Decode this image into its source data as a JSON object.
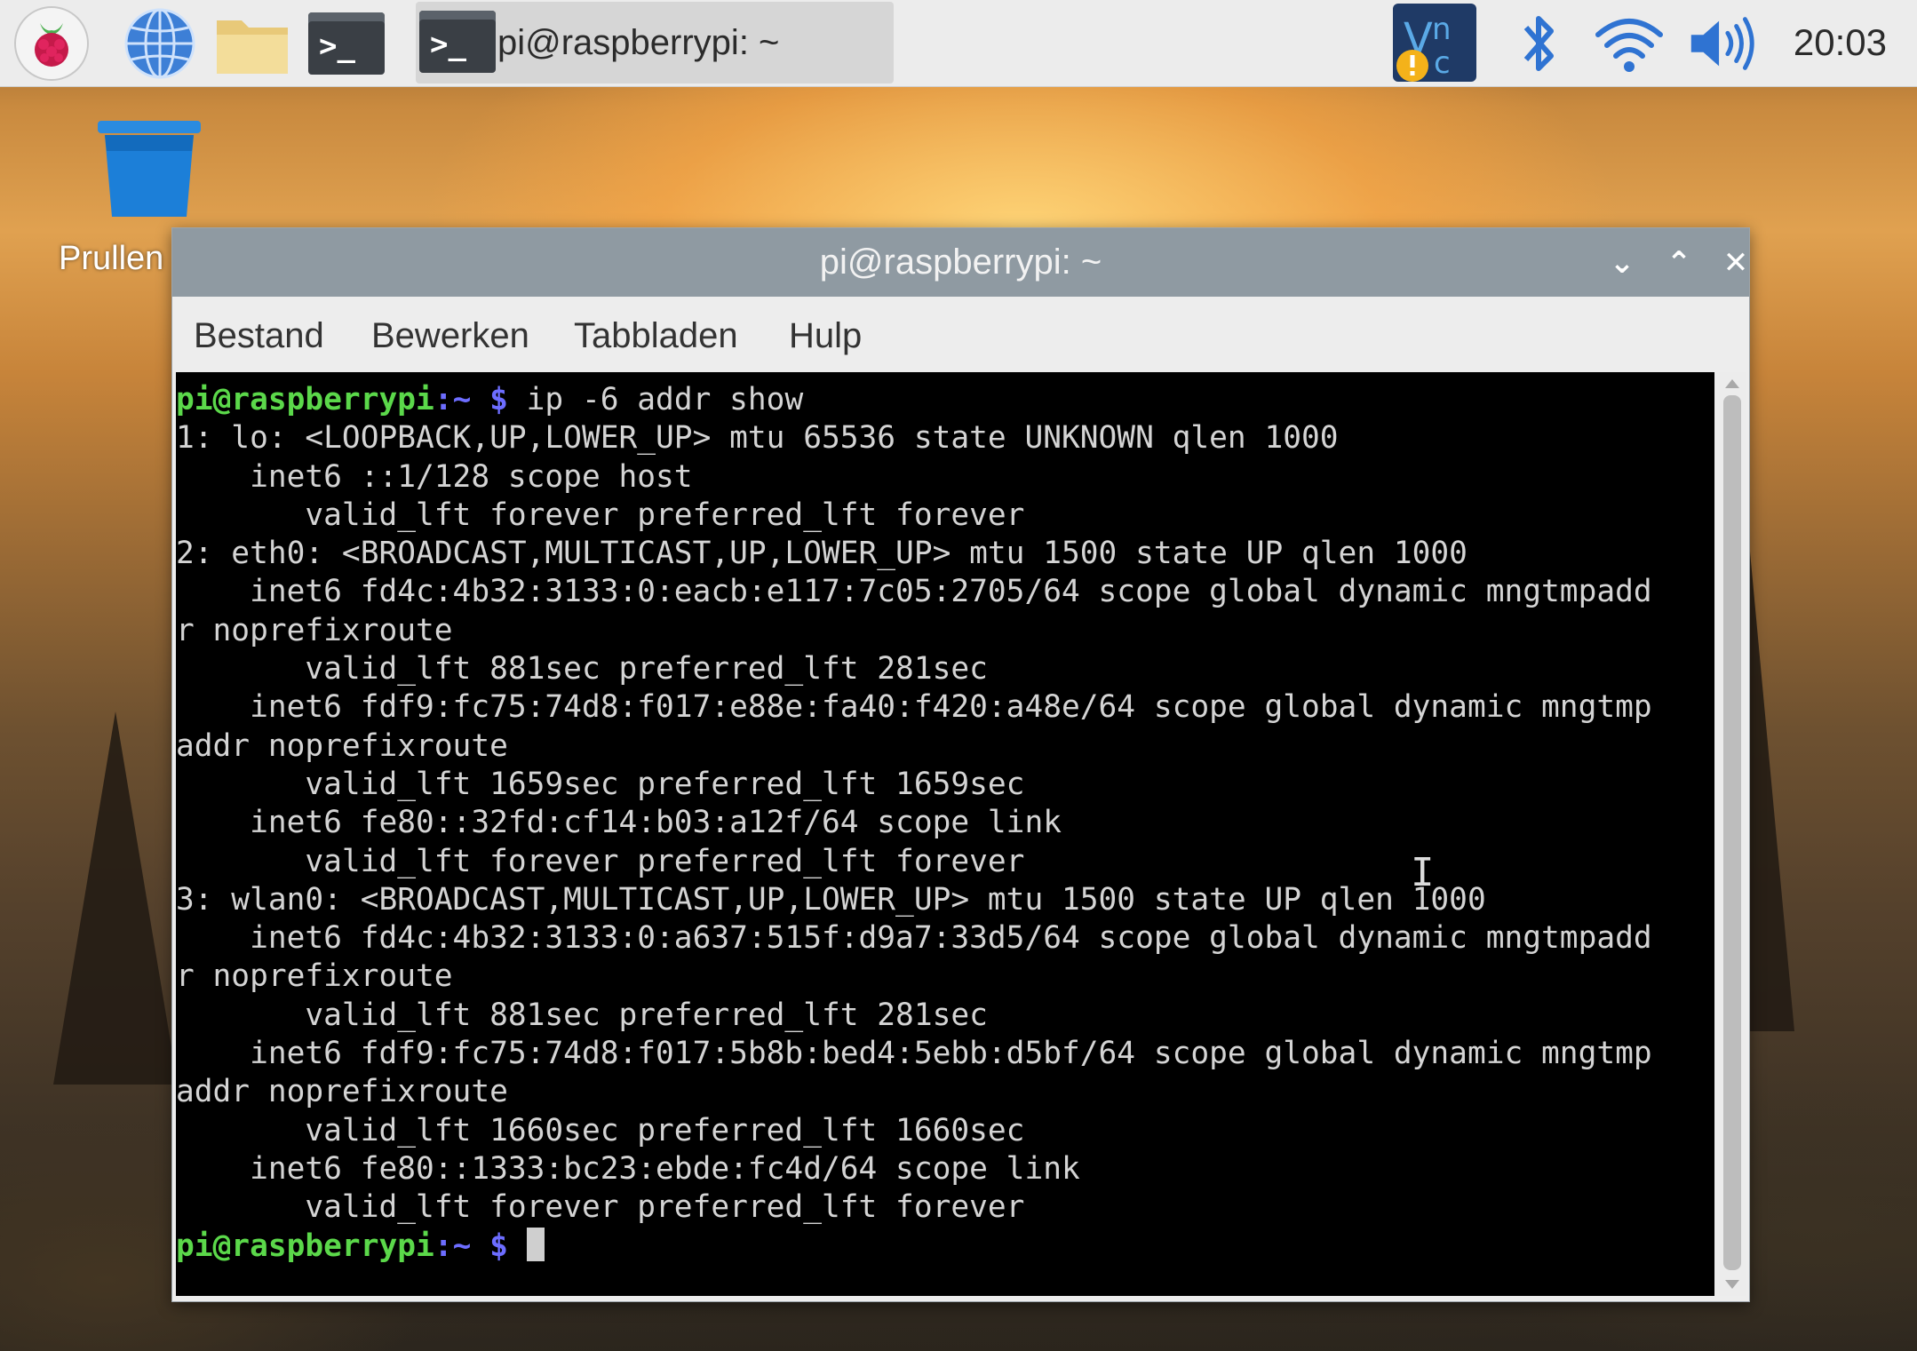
{
  "taskbar": {
    "launchers": [
      {
        "name": "raspberry-menu-icon"
      },
      {
        "name": "web-browser-icon"
      },
      {
        "name": "file-manager-icon"
      },
      {
        "name": "terminal-icon"
      }
    ],
    "task": {
      "title": "pi@raspberrypi: ~"
    },
    "tray": [
      "vnc-icon",
      "bluetooth-icon",
      "wifi-icon",
      "volume-icon"
    ],
    "clock": "20:03"
  },
  "desktop": {
    "trash_label": "Prullen"
  },
  "window": {
    "title": "pi@raspberrypi: ~",
    "controls": {
      "minimize": "⌄",
      "maximize": "⌃",
      "close": "✕"
    },
    "menu": [
      "Bestand",
      "Bewerken",
      "Tabbladen",
      "Hulp"
    ],
    "terminal": {
      "prompt_user": "pi@raspberrypi",
      "prompt_path": ":~",
      "prompt_sign": " $",
      "command": " ip -6 addr show",
      "output": [
        "1: lo: <LOOPBACK,UP,LOWER_UP> mtu 65536 state UNKNOWN qlen 1000",
        "    inet6 ::1/128 scope host",
        "       valid_lft forever preferred_lft forever",
        "2: eth0: <BROADCAST,MULTICAST,UP,LOWER_UP> mtu 1500 state UP qlen 1000",
        "    inet6 fd4c:4b32:3133:0:eacb:e117:7c05:2705/64 scope global dynamic mngtmpadd",
        "r noprefixroute",
        "       valid_lft 881sec preferred_lft 281sec",
        "    inet6 fdf9:fc75:74d8:f017:e88e:fa40:f420:a48e/64 scope global dynamic mngtmp",
        "addr noprefixroute",
        "       valid_lft 1659sec preferred_lft 1659sec",
        "    inet6 fe80::32fd:cf14:b03:a12f/64 scope link",
        "       valid_lft forever preferred_lft forever",
        "3: wlan0: <BROADCAST,MULTICAST,UP,LOWER_UP> mtu 1500 state UP qlen 1000",
        "    inet6 fd4c:4b32:3133:0:a637:515f:d9a7:33d5/64 scope global dynamic mngtmpadd",
        "r noprefixroute",
        "       valid_lft 881sec preferred_lft 281sec",
        "    inet6 fdf9:fc75:74d8:f017:5b8b:bed4:5ebb:d5bf/64 scope global dynamic mngtmp",
        "addr noprefixroute",
        "       valid_lft 1660sec preferred_lft 1660sec",
        "    inet6 fe80::1333:bc23:ebde:fc4d/64 scope link",
        "       valid_lft forever preferred_lft forever"
      ]
    }
  },
  "colors": {
    "prompt_user": "#5bd84a",
    "prompt_sign": "#6d6dff",
    "titlebar": "#8f9aa2"
  }
}
